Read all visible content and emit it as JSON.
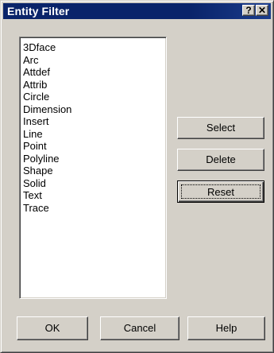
{
  "window": {
    "title": "Entity Filter",
    "help_button": "?",
    "close_button": "✕"
  },
  "entity_list": {
    "items": [
      "3Dface",
      "Arc",
      "Attdef",
      "Attrib",
      "Circle",
      "Dimension",
      "Insert",
      "Line",
      "Point",
      "Polyline",
      "Shape",
      "Solid",
      "Text",
      "Trace"
    ]
  },
  "actions": {
    "select_label": "Select",
    "delete_label": "Delete",
    "reset_label": "Reset"
  },
  "footer": {
    "ok_label": "OK",
    "cancel_label": "Cancel",
    "help_label": "Help"
  }
}
